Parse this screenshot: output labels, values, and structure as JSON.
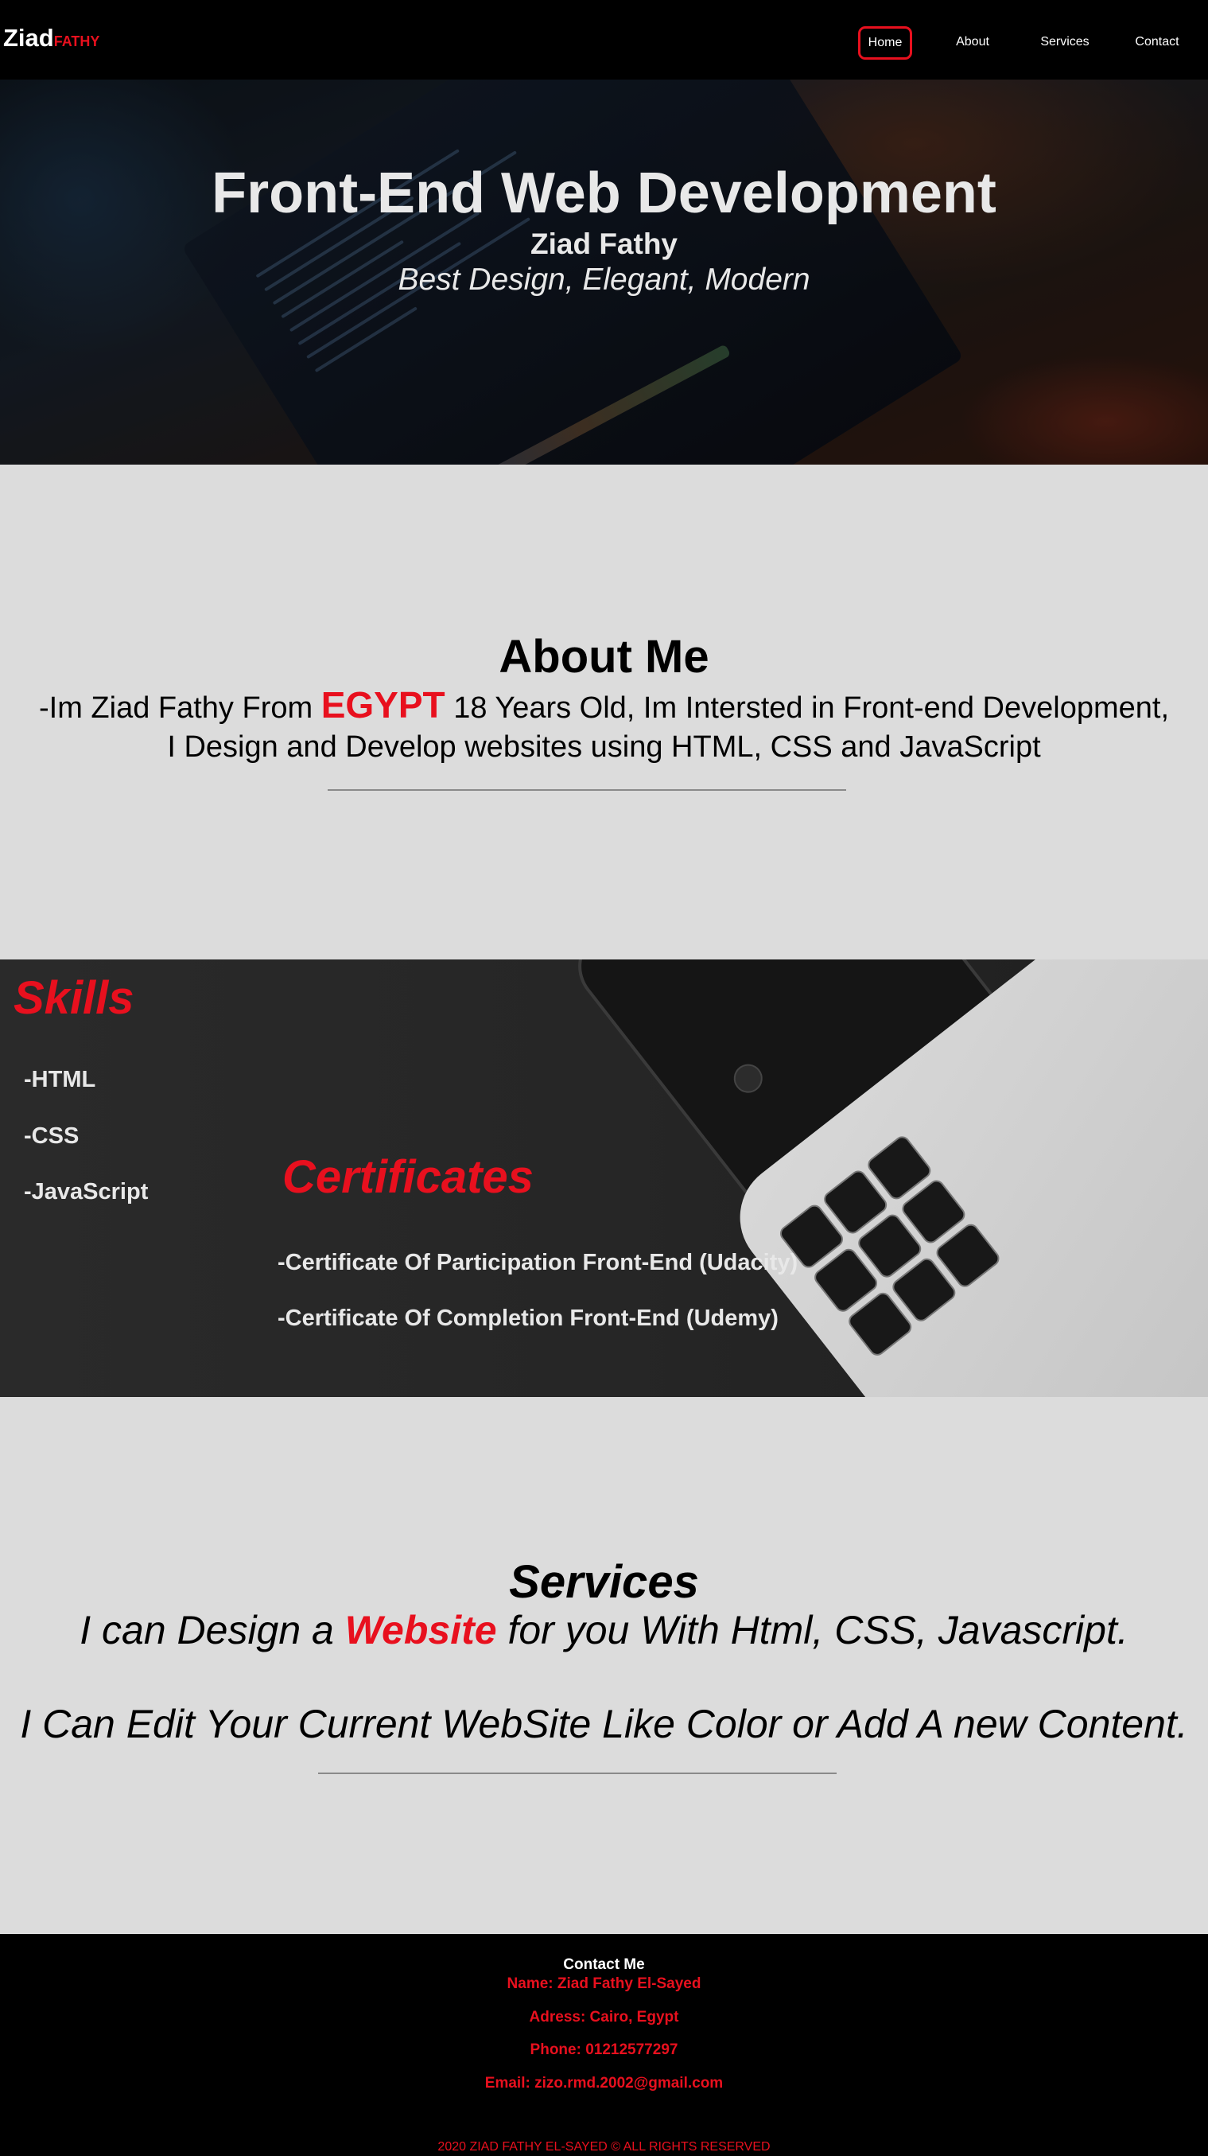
{
  "nav": {
    "logo_main": "Ziad",
    "logo_accent": "FATHY",
    "links": [
      "Home",
      "About",
      "Services",
      "Contact"
    ],
    "active": "Home"
  },
  "hero": {
    "title": "Front-End Web Development",
    "name": "Ziad Fathy",
    "tagline": "Best Design, Elegant, Modern"
  },
  "about": {
    "title": "About Me",
    "line1_prefix": "-Im Ziad Fathy From ",
    "line1_highlight": "EGYPT",
    "line1_suffix": " 18 Years Old, Im Intersted in Front-end Development,",
    "line2": "I Design and Develop websites using HTML, CSS and JavaScript"
  },
  "skills": {
    "title": "Skills",
    "items": [
      "-HTML",
      "-CSS",
      "-JavaScript"
    ]
  },
  "certificates": {
    "title": "Certificates",
    "items": [
      "-Certificate Of Participation Front-End (Udacity)",
      "-Certificate Of Completion Front-End (Udemy)"
    ]
  },
  "services": {
    "title": "Services",
    "line1_prefix": "I can Design a ",
    "line1_highlight": "Website",
    "line1_suffix": " for you With Html, CSS, Javascript.",
    "line2": "I Can Edit Your Current WebSite Like Color or Add A new Content."
  },
  "footer": {
    "contact_title": "Contact Me",
    "name": "Name: Ziad Fathy El-Sayed",
    "address": "Adress: Cairo, Egypt",
    "phone": "Phone: 01212577297",
    "email": "Email: zizo.rmd.2002@gmail.com",
    "copyright": "2020 ZIAD FATHY EL-SAYED © ALL RIGHTS RESERVED"
  },
  "colors": {
    "accent": "#e8101e",
    "nav_bg": "#000000",
    "page_bg": "#dcdcdc"
  }
}
